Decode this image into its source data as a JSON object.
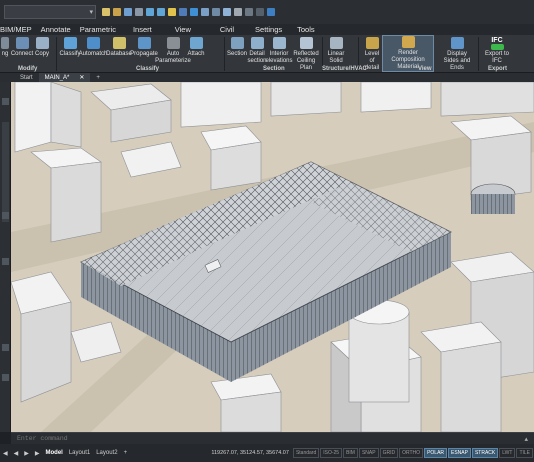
{
  "titlebar": {
    "search_value": "",
    "dropdown_arrow": "▾"
  },
  "menu": [
    "BIM/MEP",
    "Annotate",
    "Parametric",
    "Insert",
    "View",
    "Civil",
    "Settings",
    "Tools"
  ],
  "ribbon": {
    "buttons": [
      {
        "label": "ng",
        "name": "rb-ng"
      },
      {
        "label": "Connect",
        "name": "rb-connect"
      },
      {
        "label": "Copy",
        "name": "rb-copy"
      },
      {
        "label": "Classify",
        "name": "rb-classify"
      },
      {
        "label": "Automatch",
        "name": "rb-automatch"
      },
      {
        "label": "Database",
        "name": "rb-database"
      },
      {
        "label": "Propagate",
        "name": "rb-propagate"
      },
      {
        "label": "Auto Parameterize",
        "name": "rb-auto-parameterize"
      },
      {
        "label": "Attach",
        "name": "rb-attach"
      },
      {
        "label": "Section",
        "name": "rb-section"
      },
      {
        "label": "Detail section",
        "name": "rb-detail-section"
      },
      {
        "label": "Interior elevations",
        "name": "rb-interior-elevations"
      },
      {
        "label": "Reflected Ceiling Plan",
        "name": "rb-reflected-ceiling-plan"
      },
      {
        "label": "Linear Solid",
        "name": "rb-linear-solid"
      },
      {
        "label": "Level of detail",
        "name": "rb-level-of-detail"
      },
      {
        "label": "Render Composition Material",
        "name": "rb-render-composition-material"
      },
      {
        "label": "Display Sides and Ends",
        "name": "rb-display-sides-and-ends"
      },
      {
        "label": "Export to IFC",
        "name": "rb-export-to-ifc"
      }
    ],
    "ifc_label": "IFC",
    "groups": [
      "Modify",
      "Classify",
      "Section",
      "Structure/HVAC",
      "View",
      "Export"
    ]
  },
  "doctabs": [
    "Start",
    "MAIN_A*"
  ],
  "doctab_add": "+",
  "cmd": {
    "placeholder": "Enter command"
  },
  "layouts": [
    "Model",
    "Layout1",
    "Layout2"
  ],
  "layout_add": "+",
  "status": {
    "coords": "119267.07, 35124.57, 35674.07",
    "style": "Standard",
    "dimstyle": "ISO-25",
    "mode": "BIM",
    "toggles": [
      {
        "label": "SNAP",
        "on": false
      },
      {
        "label": "GRID",
        "on": false
      },
      {
        "label": "ORTHO",
        "on": false
      },
      {
        "label": "POLAR",
        "on": true
      },
      {
        "label": "ESNAP",
        "on": true
      },
      {
        "label": "STRACK",
        "on": true
      },
      {
        "label": "LWT",
        "on": false
      },
      {
        "label": "TILE",
        "on": false
      }
    ]
  },
  "colors": {
    "accent": "#6e8aa5",
    "ground": "#d4cbbb",
    "building": "#efefef",
    "roof": "#b9bdc2"
  }
}
